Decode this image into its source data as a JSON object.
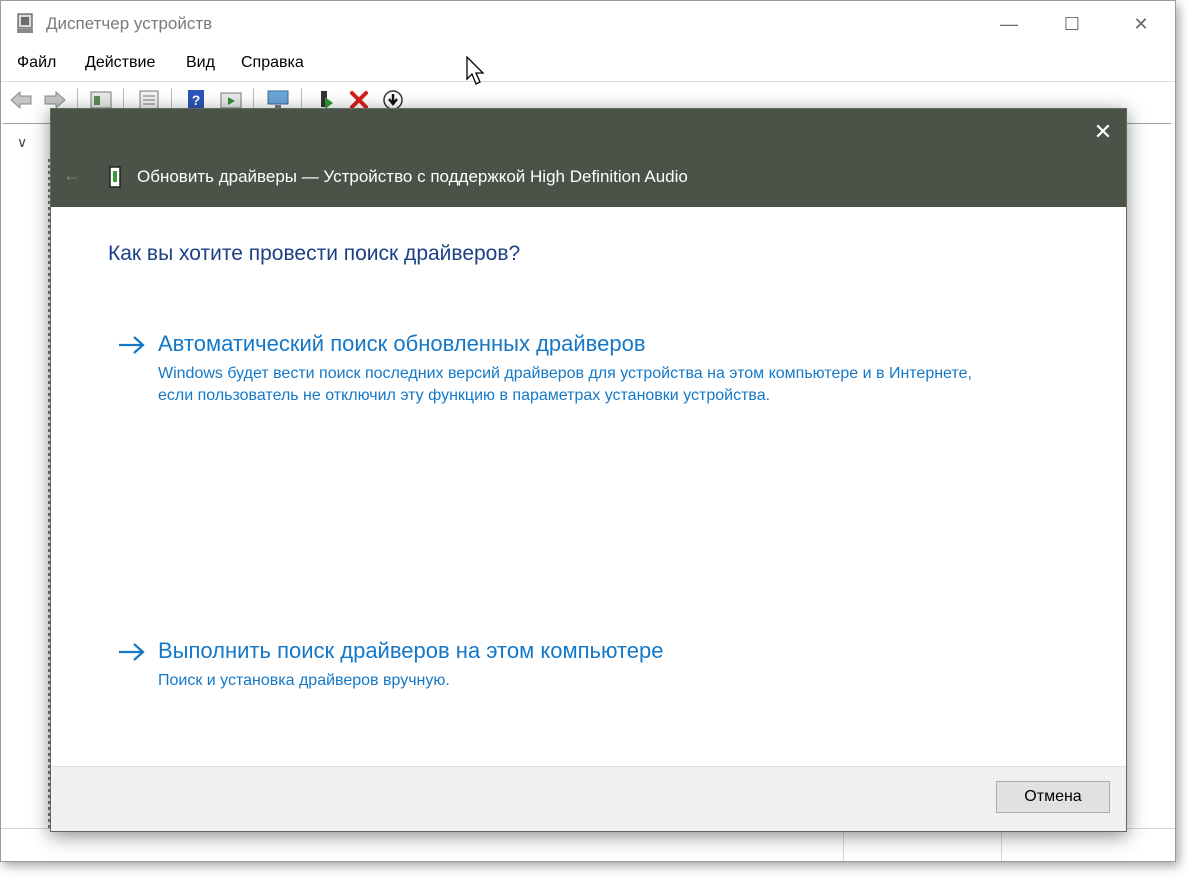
{
  "window": {
    "title": "Диспетчер устройств",
    "controls": {
      "minimize": "—",
      "maximize": "☐",
      "close": "✕"
    }
  },
  "menubar": {
    "items": [
      {
        "label": "Файл"
      },
      {
        "label": "Действие"
      },
      {
        "label": "Вид"
      },
      {
        "label": "Справка"
      }
    ]
  },
  "toolbar": {
    "icons": [
      "back-arrow-icon",
      "forward-arrow-icon",
      "properties-icon",
      "list-icon",
      "help-icon",
      "update-driver-icon",
      "monitor-icon",
      "enable-device-icon",
      "uninstall-device-icon",
      "scan-hardware-icon"
    ]
  },
  "tree": {
    "toggle": "∨"
  },
  "dialog": {
    "title": "Обновить драйверы — Устройство с поддержкой High Definition Audio",
    "back": "←",
    "close": "✕",
    "question": "Как вы хотите провести поиск драйверов?",
    "options": [
      {
        "title": "Автоматический поиск обновленных драйверов",
        "description": "Windows будет вести поиск последних версий драйверов для устройства на этом компьютере и в Интернете, если пользователь не отключил эту функцию в параметрах установки устройства."
      },
      {
        "title": "Выполнить поиск драйверов на этом компьютере",
        "description": "Поиск и установка драйверов вручную."
      }
    ],
    "cancel_label": "Отмена"
  },
  "colors": {
    "dialog_header": "#4b5349",
    "link_blue": "#1478c8",
    "heading_blue": "#1c3f86"
  }
}
